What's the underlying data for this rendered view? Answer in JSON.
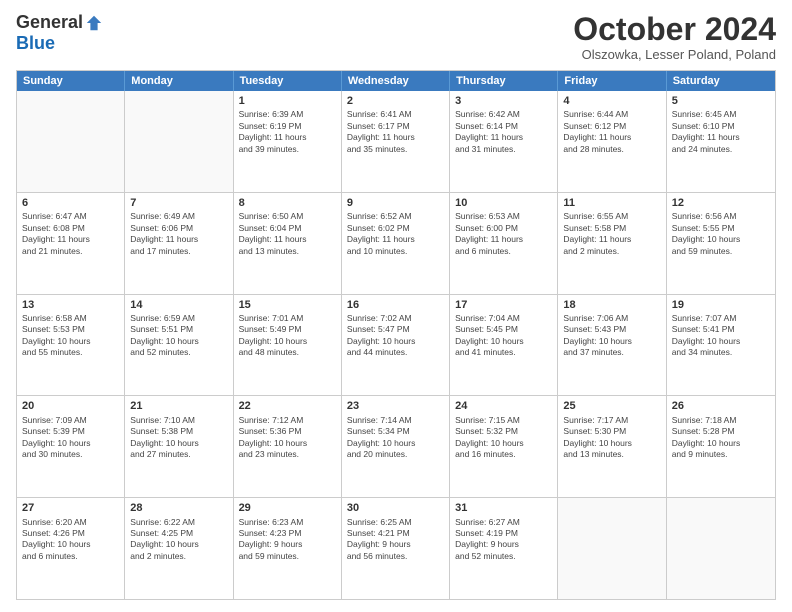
{
  "header": {
    "logo_general": "General",
    "logo_blue": "Blue",
    "main_title": "October 2024",
    "subtitle": "Olszowka, Lesser Poland, Poland"
  },
  "calendar": {
    "days": [
      "Sunday",
      "Monday",
      "Tuesday",
      "Wednesday",
      "Thursday",
      "Friday",
      "Saturday"
    ],
    "rows": [
      [
        {
          "day": "",
          "lines": []
        },
        {
          "day": "",
          "lines": []
        },
        {
          "day": "1",
          "lines": [
            "Sunrise: 6:39 AM",
            "Sunset: 6:19 PM",
            "Daylight: 11 hours",
            "and 39 minutes."
          ]
        },
        {
          "day": "2",
          "lines": [
            "Sunrise: 6:41 AM",
            "Sunset: 6:17 PM",
            "Daylight: 11 hours",
            "and 35 minutes."
          ]
        },
        {
          "day": "3",
          "lines": [
            "Sunrise: 6:42 AM",
            "Sunset: 6:14 PM",
            "Daylight: 11 hours",
            "and 31 minutes."
          ]
        },
        {
          "day": "4",
          "lines": [
            "Sunrise: 6:44 AM",
            "Sunset: 6:12 PM",
            "Daylight: 11 hours",
            "and 28 minutes."
          ]
        },
        {
          "day": "5",
          "lines": [
            "Sunrise: 6:45 AM",
            "Sunset: 6:10 PM",
            "Daylight: 11 hours",
            "and 24 minutes."
          ]
        }
      ],
      [
        {
          "day": "6",
          "lines": [
            "Sunrise: 6:47 AM",
            "Sunset: 6:08 PM",
            "Daylight: 11 hours",
            "and 21 minutes."
          ]
        },
        {
          "day": "7",
          "lines": [
            "Sunrise: 6:49 AM",
            "Sunset: 6:06 PM",
            "Daylight: 11 hours",
            "and 17 minutes."
          ]
        },
        {
          "day": "8",
          "lines": [
            "Sunrise: 6:50 AM",
            "Sunset: 6:04 PM",
            "Daylight: 11 hours",
            "and 13 minutes."
          ]
        },
        {
          "day": "9",
          "lines": [
            "Sunrise: 6:52 AM",
            "Sunset: 6:02 PM",
            "Daylight: 11 hours",
            "and 10 minutes."
          ]
        },
        {
          "day": "10",
          "lines": [
            "Sunrise: 6:53 AM",
            "Sunset: 6:00 PM",
            "Daylight: 11 hours",
            "and 6 minutes."
          ]
        },
        {
          "day": "11",
          "lines": [
            "Sunrise: 6:55 AM",
            "Sunset: 5:58 PM",
            "Daylight: 11 hours",
            "and 2 minutes."
          ]
        },
        {
          "day": "12",
          "lines": [
            "Sunrise: 6:56 AM",
            "Sunset: 5:55 PM",
            "Daylight: 10 hours",
            "and 59 minutes."
          ]
        }
      ],
      [
        {
          "day": "13",
          "lines": [
            "Sunrise: 6:58 AM",
            "Sunset: 5:53 PM",
            "Daylight: 10 hours",
            "and 55 minutes."
          ]
        },
        {
          "day": "14",
          "lines": [
            "Sunrise: 6:59 AM",
            "Sunset: 5:51 PM",
            "Daylight: 10 hours",
            "and 52 minutes."
          ]
        },
        {
          "day": "15",
          "lines": [
            "Sunrise: 7:01 AM",
            "Sunset: 5:49 PM",
            "Daylight: 10 hours",
            "and 48 minutes."
          ]
        },
        {
          "day": "16",
          "lines": [
            "Sunrise: 7:02 AM",
            "Sunset: 5:47 PM",
            "Daylight: 10 hours",
            "and 44 minutes."
          ]
        },
        {
          "day": "17",
          "lines": [
            "Sunrise: 7:04 AM",
            "Sunset: 5:45 PM",
            "Daylight: 10 hours",
            "and 41 minutes."
          ]
        },
        {
          "day": "18",
          "lines": [
            "Sunrise: 7:06 AM",
            "Sunset: 5:43 PM",
            "Daylight: 10 hours",
            "and 37 minutes."
          ]
        },
        {
          "day": "19",
          "lines": [
            "Sunrise: 7:07 AM",
            "Sunset: 5:41 PM",
            "Daylight: 10 hours",
            "and 34 minutes."
          ]
        }
      ],
      [
        {
          "day": "20",
          "lines": [
            "Sunrise: 7:09 AM",
            "Sunset: 5:39 PM",
            "Daylight: 10 hours",
            "and 30 minutes."
          ]
        },
        {
          "day": "21",
          "lines": [
            "Sunrise: 7:10 AM",
            "Sunset: 5:38 PM",
            "Daylight: 10 hours",
            "and 27 minutes."
          ]
        },
        {
          "day": "22",
          "lines": [
            "Sunrise: 7:12 AM",
            "Sunset: 5:36 PM",
            "Daylight: 10 hours",
            "and 23 minutes."
          ]
        },
        {
          "day": "23",
          "lines": [
            "Sunrise: 7:14 AM",
            "Sunset: 5:34 PM",
            "Daylight: 10 hours",
            "and 20 minutes."
          ]
        },
        {
          "day": "24",
          "lines": [
            "Sunrise: 7:15 AM",
            "Sunset: 5:32 PM",
            "Daylight: 10 hours",
            "and 16 minutes."
          ]
        },
        {
          "day": "25",
          "lines": [
            "Sunrise: 7:17 AM",
            "Sunset: 5:30 PM",
            "Daylight: 10 hours",
            "and 13 minutes."
          ]
        },
        {
          "day": "26",
          "lines": [
            "Sunrise: 7:18 AM",
            "Sunset: 5:28 PM",
            "Daylight: 10 hours",
            "and 9 minutes."
          ]
        }
      ],
      [
        {
          "day": "27",
          "lines": [
            "Sunrise: 6:20 AM",
            "Sunset: 4:26 PM",
            "Daylight: 10 hours",
            "and 6 minutes."
          ]
        },
        {
          "day": "28",
          "lines": [
            "Sunrise: 6:22 AM",
            "Sunset: 4:25 PM",
            "Daylight: 10 hours",
            "and 2 minutes."
          ]
        },
        {
          "day": "29",
          "lines": [
            "Sunrise: 6:23 AM",
            "Sunset: 4:23 PM",
            "Daylight: 9 hours",
            "and 59 minutes."
          ]
        },
        {
          "day": "30",
          "lines": [
            "Sunrise: 6:25 AM",
            "Sunset: 4:21 PM",
            "Daylight: 9 hours",
            "and 56 minutes."
          ]
        },
        {
          "day": "31",
          "lines": [
            "Sunrise: 6:27 AM",
            "Sunset: 4:19 PM",
            "Daylight: 9 hours",
            "and 52 minutes."
          ]
        },
        {
          "day": "",
          "lines": []
        },
        {
          "day": "",
          "lines": []
        }
      ]
    ]
  }
}
